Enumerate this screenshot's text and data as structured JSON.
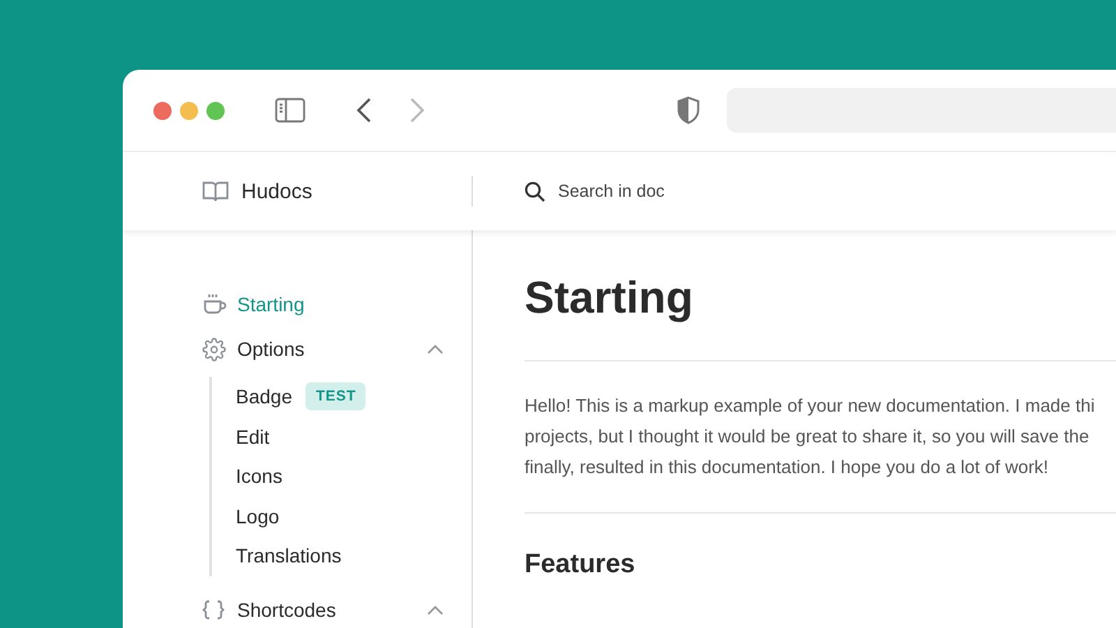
{
  "browser": {
    "back_enabled": true,
    "forward_enabled": false
  },
  "header": {
    "brand": "Hudocs",
    "search": {
      "placeholder": "Search in doc"
    }
  },
  "sidebar": {
    "items": [
      {
        "label": "Starting",
        "selected": true
      },
      {
        "label": "Options",
        "selected": false,
        "expanded": true,
        "children": [
          {
            "label": "Badge",
            "selected": false,
            "badge": "TEST"
          },
          {
            "label": "Edit",
            "selected": false
          },
          {
            "label": "Icons",
            "selected": false
          },
          {
            "label": "Logo",
            "selected": false
          },
          {
            "label": "Translations",
            "selected": false
          }
        ]
      },
      {
        "label": "Shortcodes",
        "selected": false,
        "expanded": true
      }
    ]
  },
  "content": {
    "title": "Starting",
    "intro_lines": [
      "Hello! This is a markup example of your new documentation. I made thi",
      "projects, but I thought it would be great to share it, so you will save the",
      "finally, resulted in this documentation. I hope you do a lot of work!"
    ],
    "section_heading": "Features"
  }
}
